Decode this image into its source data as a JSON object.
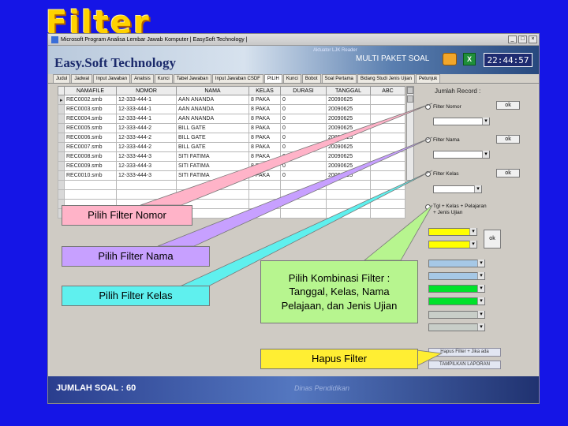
{
  "slide_title": "Filter",
  "window": {
    "title": "Microsoft  Program Analisa Lembar Jawab Komputer  |  EasySoft Technology |",
    "controls": [
      "_",
      "□",
      "×"
    ]
  },
  "banner": {
    "brand": "Easy.Soft Technology",
    "reader": "Aktuator LJK Reader",
    "mode": "MULTI PAKET SOAL",
    "clock": "22:44:57",
    "icons": [
      "palette-icon",
      "excel-icon"
    ]
  },
  "tabs": [
    "Judul",
    "Jadwal",
    "Input Jawaban",
    "Analisis",
    "Kunci",
    "Tabel Jawaban",
    "Input Jawaban CSDF",
    "PILIH",
    "Kunci",
    "Bobot",
    "Soal Pertama",
    "Bidang Studi Jenis Ujian",
    "Petunjuk"
  ],
  "grid": {
    "columns": [
      "NAMAFILE",
      "NOMOR",
      "NAMA",
      "KELAS",
      "DURASI",
      "TANGGAL",
      "ABC"
    ],
    "rows": [
      [
        "REC0002.smb",
        "12-333-444-1",
        "AAN ANANDA",
        "8 PAKA",
        "0",
        "20090625",
        ""
      ],
      [
        "REC0003.smb",
        "12-333-444-1",
        "AAN ANANDA",
        "8 PAKA",
        "0",
        "20090625",
        ""
      ],
      [
        "REC0004.smb",
        "12-333-444-1",
        "AAN ANANDA",
        "8 PAKA",
        "0",
        "20090625",
        ""
      ],
      [
        "REC0005.smb",
        "12-333-444-2",
        "BILL GATE",
        "8 PAKA",
        "0",
        "20090625",
        ""
      ],
      [
        "REC0006.smb",
        "12-333-444-2",
        "BILL GATE",
        "8 PAKA",
        "0",
        "20090625",
        ""
      ],
      [
        "REC0007.smb",
        "12-333-444-2",
        "BILL GATE",
        "8 PAKA",
        "0",
        "20090625",
        ""
      ],
      [
        "REC0008.smb",
        "12-333-444-3",
        "SITI FATIMA",
        "8 PAKA",
        "0",
        "20090625",
        ""
      ],
      [
        "REC0009.smb",
        "12-333-444-3",
        "SITI FATIMA",
        "8 PAKA",
        "0",
        "20090625",
        ""
      ],
      [
        "REC0010.smb",
        "12-333-444-3",
        "SITI FATIMA",
        "8 PAKA",
        "0",
        "20090625",
        ""
      ]
    ]
  },
  "panel": {
    "jumlah_record": "Jumlah Record :",
    "filter_nomor": "Filter Nomor",
    "filter_nama": "Filter Nama",
    "filter_kelas": "Filter Kelas",
    "filter_kombinasi_1": "Tgl + Kelas + Pelajaran",
    "filter_kombinasi_2": "+ Jenis Ujian",
    "ok": "ok",
    "hapus_filter": "Hapus Filter + Jika ada",
    "tampilkan": "TAMPILKAN LAPORAN"
  },
  "status": {
    "jumlah_soal": "JUMLAH SOAL : 60",
    "signature": "Dinas Pendidikan"
  },
  "callouts": {
    "nomor": "Pilih Filter Nomor",
    "nama": "Pilih Filter Nama",
    "kelas": "Pilih Filter Kelas",
    "kombinasi": "Pilih Kombinasi Filter : Tanggal, Kelas, Nama Pelajaan, dan Jenis Ujian",
    "hapus": "Hapus Filter"
  },
  "colors": {
    "background": "#1515e6",
    "title": "#ffd200",
    "callout_pink": "#ffb3c8",
    "callout_violet": "#c7a0ff",
    "callout_cyan": "#5ff0ee",
    "callout_green": "#b7f58f",
    "callout_yellow": "#ffee33"
  }
}
